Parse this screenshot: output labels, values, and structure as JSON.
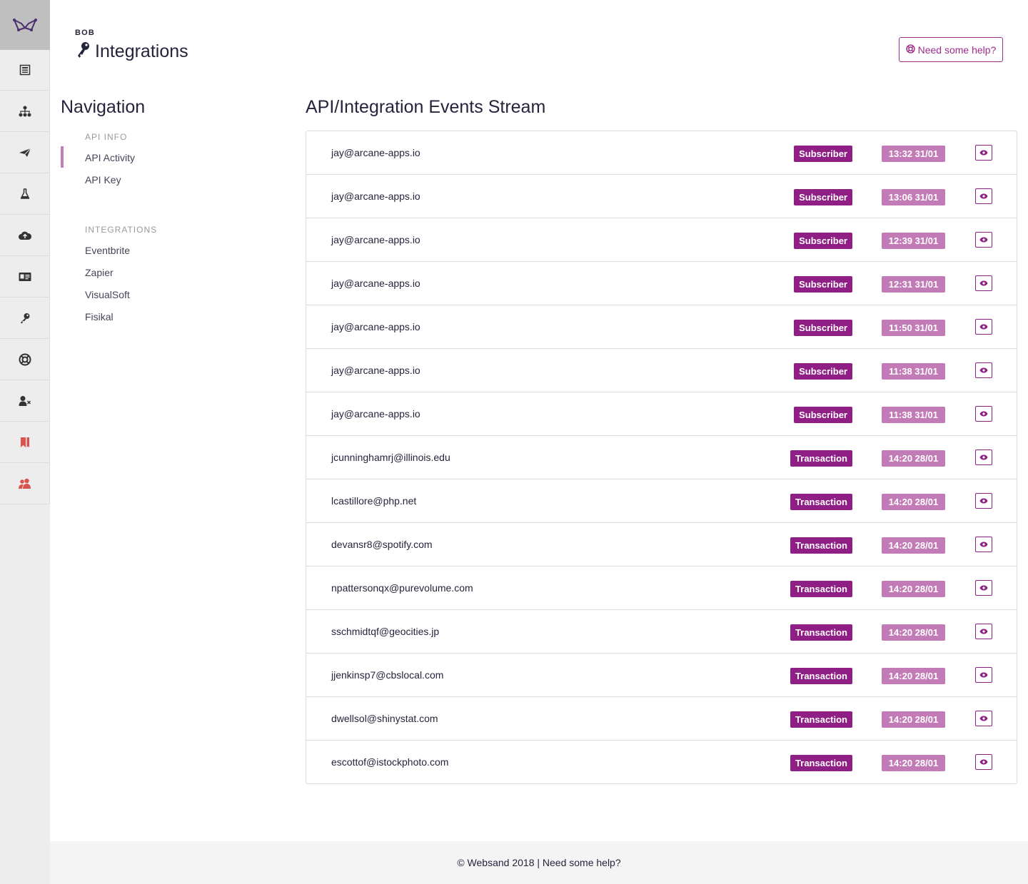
{
  "header": {
    "org_label": "BOB",
    "title": "Integrations",
    "help_button": "Need some help?"
  },
  "rail": {
    "logo_icon": "websand-logo-icon",
    "items": [
      {
        "icon": "dashboard-icon"
      },
      {
        "icon": "sitemap-icon"
      },
      {
        "icon": "paper-plane-icon"
      },
      {
        "icon": "flask-icon"
      },
      {
        "icon": "cloud-upload-icon"
      },
      {
        "icon": "id-card-icon"
      },
      {
        "icon": "key-icon"
      },
      {
        "icon": "lifebuoy-icon"
      },
      {
        "icon": "user-remove-icon"
      },
      {
        "icon": "bookmark-icon",
        "color": "#d9534f"
      },
      {
        "icon": "users-icon",
        "color": "#d9534f"
      }
    ]
  },
  "navigation": {
    "title": "Navigation",
    "api_section": "API INFO",
    "api_items": [
      "API Activity",
      "API Key"
    ],
    "integrations_section": "INTEGRATIONS",
    "integration_items": [
      "Eventbrite",
      "Zapier",
      "VisualSoft",
      "Fisikal"
    ]
  },
  "stream": {
    "title": "API/Integration Events Stream",
    "rows": [
      {
        "email": "jay@arcane-apps.io",
        "type": "Subscriber",
        "time": "13:32 31/01"
      },
      {
        "email": "jay@arcane-apps.io",
        "type": "Subscriber",
        "time": "13:06 31/01"
      },
      {
        "email": "jay@arcane-apps.io",
        "type": "Subscriber",
        "time": "12:39 31/01"
      },
      {
        "email": "jay@arcane-apps.io",
        "type": "Subscriber",
        "time": "12:31 31/01"
      },
      {
        "email": "jay@arcane-apps.io",
        "type": "Subscriber",
        "time": "11:50 31/01"
      },
      {
        "email": "jay@arcane-apps.io",
        "type": "Subscriber",
        "time": "11:38 31/01"
      },
      {
        "email": "jay@arcane-apps.io",
        "type": "Subscriber",
        "time": "11:38 31/01"
      },
      {
        "email": "jcunninghamrj@illinois.edu",
        "type": "Transaction",
        "time": "14:20 28/01"
      },
      {
        "email": "lcastillore@php.net",
        "type": "Transaction",
        "time": "14:20 28/01"
      },
      {
        "email": "devansr8@spotify.com",
        "type": "Transaction",
        "time": "14:20 28/01"
      },
      {
        "email": "npattersonqx@purevolume.com",
        "type": "Transaction",
        "time": "14:20 28/01"
      },
      {
        "email": "sschmidtqf@geocities.jp",
        "type": "Transaction",
        "time": "14:20 28/01"
      },
      {
        "email": "jjenkinsp7@cbslocal.com",
        "type": "Transaction",
        "time": "14:20 28/01"
      },
      {
        "email": "dwellsol@shinystat.com",
        "type": "Transaction",
        "time": "14:20 28/01"
      },
      {
        "email": "escottof@istockphoto.com",
        "type": "Transaction",
        "time": "14:20 28/01"
      }
    ]
  },
  "footer": {
    "text": "© Websand 2018 | Need some help?"
  },
  "colors": {
    "brand": "#8f1f84",
    "badge_light": "#c27bb6",
    "accent_red": "#d9534f"
  }
}
